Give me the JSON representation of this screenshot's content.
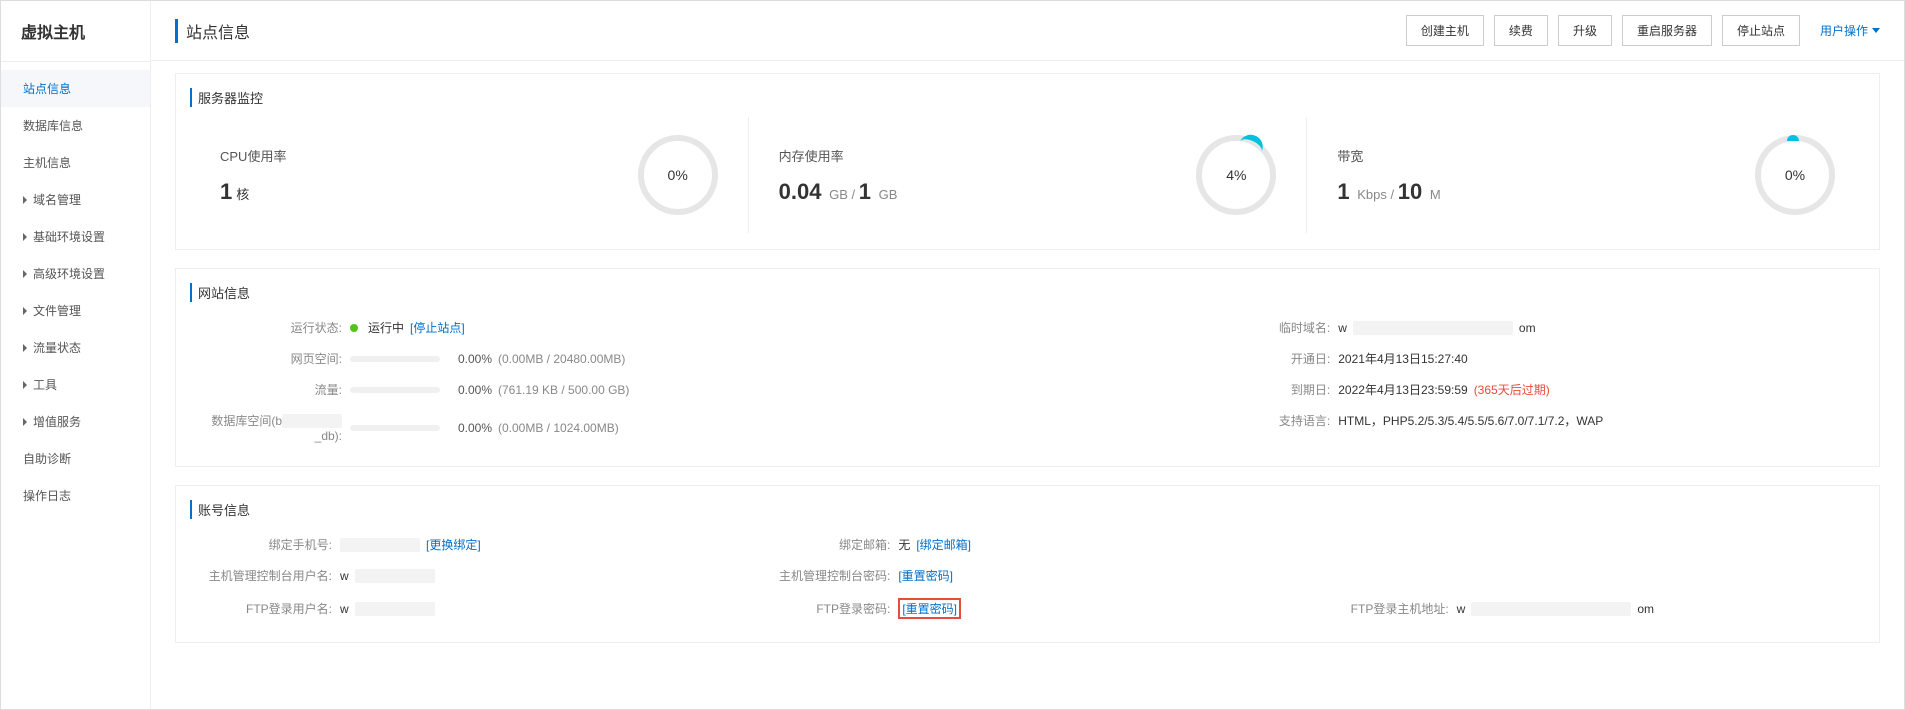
{
  "sidebar": {
    "title": "虚拟主机",
    "items": [
      {
        "label": "站点信息",
        "active": true,
        "expandable": false
      },
      {
        "label": "数据库信息",
        "expandable": false
      },
      {
        "label": "主机信息",
        "expandable": false
      },
      {
        "label": "域名管理",
        "expandable": true
      },
      {
        "label": "基础环境设置",
        "expandable": true
      },
      {
        "label": "高级环境设置",
        "expandable": true
      },
      {
        "label": "文件管理",
        "expandable": true
      },
      {
        "label": "流量状态",
        "expandable": true
      },
      {
        "label": "工具",
        "expandable": true
      },
      {
        "label": "增值服务",
        "expandable": true
      },
      {
        "label": "自助诊断",
        "expandable": false
      },
      {
        "label": "操作日志",
        "expandable": false
      }
    ]
  },
  "header": {
    "title": "站点信息",
    "buttons": [
      "创建主机",
      "续费",
      "升级",
      "重启服务器",
      "停止站点"
    ],
    "user_op": "用户操作"
  },
  "monitor": {
    "title": "服务器监控",
    "cpu": {
      "label": "CPU使用率",
      "value_big": "1",
      "value_unit": "核",
      "pct": "0%"
    },
    "mem": {
      "label": "内存使用率",
      "value_line": "0.04 GB / 1 GB",
      "value_big": "0.04",
      "value_unit_a": "GB /",
      "value_b": "1",
      "value_unit_b": "GB",
      "pct": "4%"
    },
    "bw": {
      "label": "带宽",
      "value_big": "1",
      "value_unit_a": "Kbps /",
      "value_b": "10",
      "value_unit_b": "M",
      "pct": "0%"
    }
  },
  "site": {
    "title": "网站信息",
    "run_status_label": "运行状态:",
    "run_status_value": "运行中",
    "run_status_action": "[停止站点]",
    "web_space_label": "网页空间:",
    "web_space_pct": "0.00%",
    "web_space_detail": "(0.00MB / 20480.00MB)",
    "flow_label": "流量:",
    "flow_pct": "0.00%",
    "flow_detail": "(761.19 KB / 500.00 GB)",
    "db_space_label_prefix": "数据库空间(b",
    "db_space_label_suffix": "_db):",
    "db_space_pct": "0.00%",
    "db_space_detail": "(0.00MB / 1024.00MB)",
    "temp_domain_label": "临时域名:",
    "temp_domain_prefix": "w",
    "temp_domain_suffix": "om",
    "open_date_label": "开通日:",
    "open_date_value": "2021年4月13日15:27:40",
    "expire_label": "到期日:",
    "expire_value": "2022年4月13日23:59:59",
    "expire_note": "(365天后过期)",
    "lang_label": "支持语言:",
    "lang_value": "HTML，PHP5.2/5.3/5.4/5.5/5.6/7.0/7.1/7.2，WAP"
  },
  "account": {
    "title": "账号信息",
    "bind_phone_label": "绑定手机号:",
    "bind_phone_action": "[更换绑定]",
    "bind_email_label": "绑定邮箱:",
    "bind_email_value": "无",
    "bind_email_action": "[绑定邮箱]",
    "console_user_label": "主机管理控制台用户名:",
    "console_user_prefix": "w",
    "console_pwd_label": "主机管理控制台密码:",
    "console_pwd_action": "[重置密码]",
    "ftp_user_label": "FTP登录用户名:",
    "ftp_user_prefix": "w",
    "ftp_pwd_label": "FTP登录密码:",
    "ftp_pwd_action": "[重置密码]",
    "ftp_host_label": "FTP登录主机地址:",
    "ftp_host_prefix": "w",
    "ftp_host_suffix": "om"
  }
}
